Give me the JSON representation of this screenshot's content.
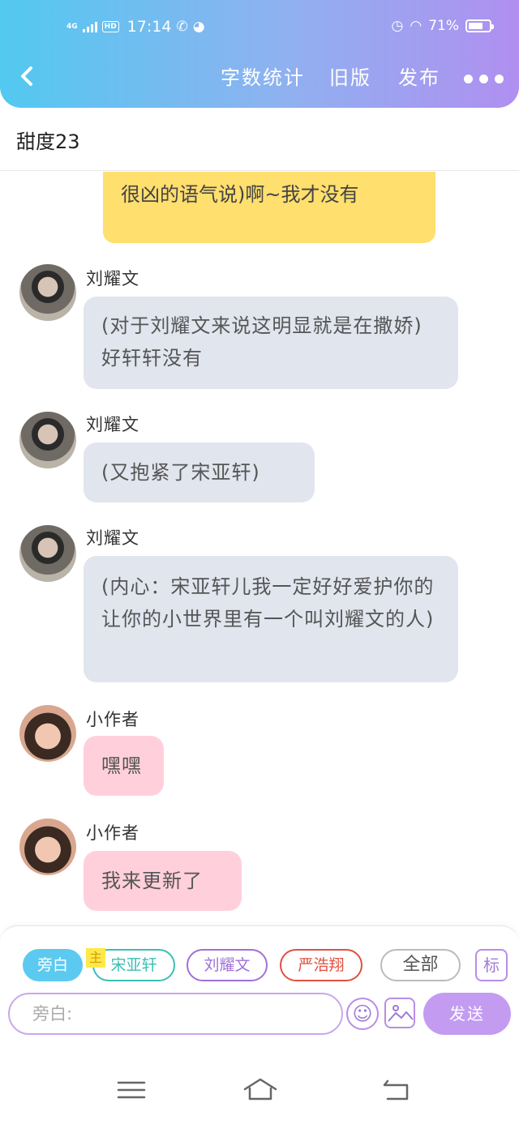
{
  "status_bar": {
    "network": "4G",
    "hd": "HD",
    "time": "17:14",
    "battery_label": "71%",
    "battery_level": 0.71
  },
  "header": {
    "back_icon": "chevron-left-icon",
    "word_count": "字数统计",
    "old_version": "旧版",
    "publish": "发布",
    "more_icon": "more-dots-icon",
    "gradient": [
      "#52c9f0",
      "#b08ff0"
    ]
  },
  "story_title": "甜度23",
  "messages": [
    {
      "sender": "",
      "text": "很凶的语气说)啊~我才没有",
      "style": "narration"
    },
    {
      "sender": "刘耀文",
      "text": "(对于刘耀文来说这明显就是在撒娇)好轩轩没有",
      "avatar": "boy"
    },
    {
      "sender": "刘耀文",
      "text": "(又抱紧了宋亚轩)",
      "avatar": "boy"
    },
    {
      "sender": "刘耀文",
      "text": "(内心：宋亚轩儿我一定好好爱护你的让你的小世界里有一个叫刘耀文的人)",
      "avatar": "boy"
    },
    {
      "sender": "小作者",
      "text": "嘿嘿",
      "avatar": "girl"
    },
    {
      "sender": "小作者",
      "text": "我来更新了",
      "avatar": "girl"
    }
  ],
  "roles": {
    "narrator": "旁白",
    "main_tag": "主",
    "song": "宋亚轩",
    "liu": "刘耀文",
    "yan": "严浩翔",
    "all": "全部",
    "tag": "标"
  },
  "colors": {
    "narrator": "#5ccaf0",
    "song": "#3cbeb4",
    "liu": "#a070d8",
    "yan": "#e05040",
    "send": "#c39cf2",
    "narration_bubble": "#ffdf6e",
    "gray_bubble": "#e1e5ee",
    "pink_bubble": "#ffd0dc"
  },
  "input": {
    "placeholder": "旁白:",
    "send": "发送",
    "emoji_icon": "smiley-icon",
    "image_icon": "image-icon"
  },
  "navbar": {
    "menu_icon": "menu-icon",
    "home_icon": "home-icon",
    "back_icon": "back-icon"
  }
}
